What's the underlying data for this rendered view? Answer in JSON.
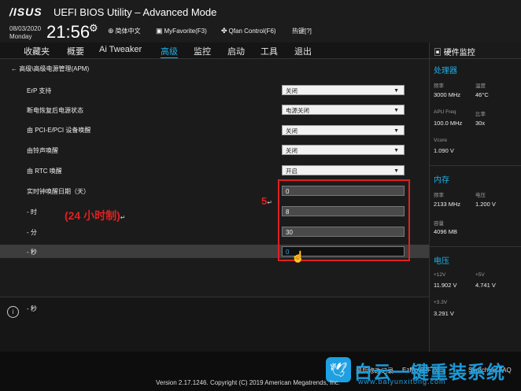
{
  "header": {
    "logo": "/ISUS",
    "title": "UEFI BIOS Utility – Advanced Mode",
    "date": "08/03/2020",
    "day": "Monday",
    "time": "21:56",
    "toolbar": [
      {
        "icon": "globe-icon",
        "label": "简体中文"
      },
      {
        "icon": "favorite-icon",
        "label": "MyFavorite(F3)"
      },
      {
        "icon": "fan-icon",
        "label": "Qfan Control(F6)"
      },
      {
        "icon": "help-icon",
        "label": "热键[?]"
      }
    ]
  },
  "menu": [
    {
      "label": "收藏夹"
    },
    {
      "label": "概要"
    },
    {
      "label": "Ai Tweaker"
    },
    {
      "label": "高级",
      "active": true
    },
    {
      "label": "监控"
    },
    {
      "label": "启动"
    },
    {
      "label": "工具"
    },
    {
      "label": "退出"
    }
  ],
  "breadcrumb": "高级\\高级电源管理(APM)",
  "settings": [
    {
      "label": "ErP 支持",
      "value": "关闭",
      "type": "select"
    },
    {
      "label": "断电恢复后电源状态",
      "value": "电源关闭",
      "type": "select"
    },
    {
      "label": "由 PCI-E/PCI 设备唤醒",
      "value": "关闭",
      "type": "select"
    },
    {
      "label": "由铃声唤醒",
      "value": "关闭",
      "type": "select"
    },
    {
      "label": "由 RTC 唤醒",
      "value": "开启",
      "type": "select"
    },
    {
      "label": "实时钟唤醒日期（天）",
      "value": "0",
      "type": "field"
    },
    {
      "label": "- 时",
      "value": "8",
      "type": "field"
    },
    {
      "label": "- 分",
      "value": "30",
      "type": "field"
    },
    {
      "label": "- 秒",
      "value": "0",
      "type": "field",
      "selected": true
    }
  ],
  "annotations": {
    "step": "5",
    "step_mark": "↵",
    "note": "(24 小时制)",
    "note_mark": "↵"
  },
  "info": {
    "icon": "info-icon",
    "text": "- 秒"
  },
  "footer": {
    "copyright": "Version 2.17.1246. Copyright (C) 2019 American Megatrends, Inc.",
    "links": [
      "最后修改记录",
      "EzMode(F7)|→",
      "Search on FAQ"
    ]
  },
  "watermark": {
    "main": "白云一键重装系统",
    "url": "www.baiyunxitong.com"
  },
  "hw_monitor": {
    "title": "硬件监控",
    "cpu": {
      "title": "处理器",
      "freq_label": "频率",
      "freq": "3000 MHz",
      "temp_label": "温度",
      "temp": "46°C",
      "apu_label": "APU Freq",
      "apu": "100.0 MHz",
      "ratio_label": "比率",
      "ratio": "30x",
      "vcore_label": "Vcore",
      "vcore": "1.090 V"
    },
    "memory": {
      "title": "内存",
      "freq_label": "频率",
      "freq": "2133 MHz",
      "volt_label": "电压",
      "volt": "1.200 V",
      "cap_label": "容量",
      "cap": "4096 MB"
    },
    "voltage": {
      "title": "电压",
      "v12_label": "+12V",
      "v12": "11.902 V",
      "v5_label": "+5V",
      "v5": "4.741 V",
      "v33_label": "+3.3V",
      "v33": "3.291 V"
    }
  },
  "colors": {
    "accent": "#1ab0e8",
    "annotation": "#e02020",
    "watermark": "#1da1e2"
  }
}
